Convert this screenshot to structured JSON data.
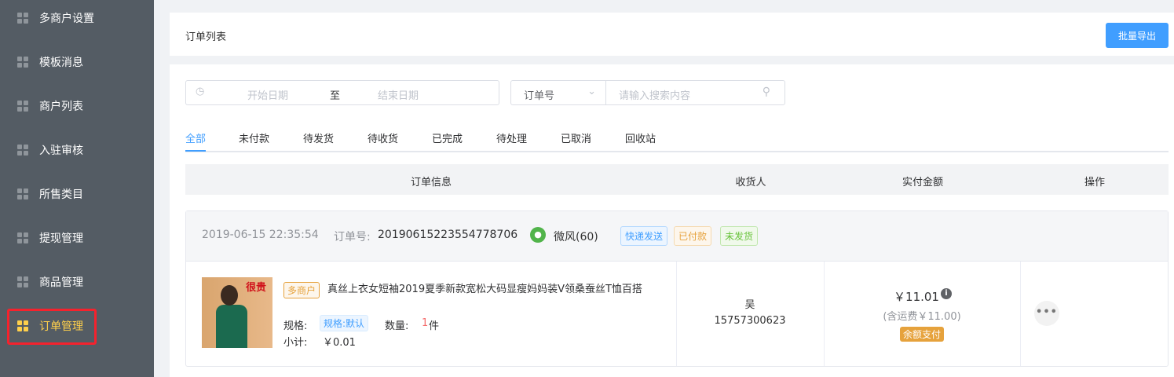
{
  "sidebar": {
    "items": [
      {
        "label": "多商户设置"
      },
      {
        "label": "模板消息"
      },
      {
        "label": "商户列表"
      },
      {
        "label": "入驻审核"
      },
      {
        "label": "所售类目"
      },
      {
        "label": "提现管理"
      },
      {
        "label": "商品管理"
      },
      {
        "label": "订单管理",
        "active": true
      }
    ]
  },
  "header": {
    "title": "订单列表",
    "export_label": "批量导出"
  },
  "filters": {
    "start_placeholder": "开始日期",
    "separator": "至",
    "end_placeholder": "结束日期",
    "search_type": "订单号",
    "search_placeholder": "请输入搜索内容"
  },
  "tabs": [
    {
      "label": "全部"
    },
    {
      "label": "未付款"
    },
    {
      "label": "待发货"
    },
    {
      "label": "待收货"
    },
    {
      "label": "已完成"
    },
    {
      "label": "待处理"
    },
    {
      "label": "已取消"
    },
    {
      "label": "回收站"
    }
  ],
  "table": {
    "columns": [
      "订单信息",
      "收货人",
      "实付金额",
      "操作"
    ]
  },
  "order": {
    "time": "2019-06-15 22:35:54",
    "no_label": "订单号:",
    "no": "20190615223554778706",
    "user": "微风(60)",
    "badges": [
      "快递发送",
      "已付款",
      "未发货"
    ],
    "product": {
      "tag": "多商户",
      "name": "真丝上衣女短袖2019夏季新款宽松大码显瘦妈妈装V领桑蚕丝T恤百搭",
      "spec_label": "规格:",
      "spec": "规格:默认",
      "qty_label": "数量:",
      "qty": "1",
      "qty_unit": "件",
      "subtotal_label": "小计:",
      "subtotal": "￥0.01",
      "image_text": "很贵"
    },
    "recipient": {
      "name": "吴",
      "phone": "15757300623"
    },
    "amount": {
      "total": "￥11.01",
      "shipping": "(含运费￥11.00)",
      "pay_method": "余额支付"
    }
  },
  "colors": {
    "accent": "#409eff",
    "sidebar": "#545c64",
    "active": "#ffd04b"
  }
}
